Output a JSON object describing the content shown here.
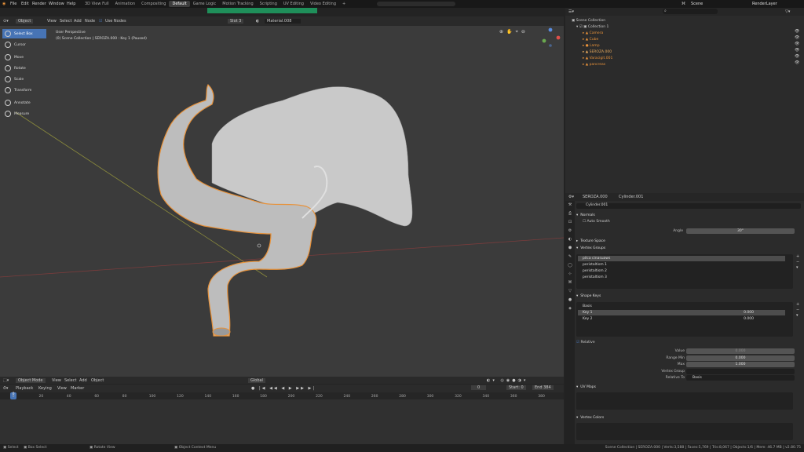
{
  "menu": [
    "File",
    "Edit",
    "Render",
    "Window",
    "Help"
  ],
  "workspaces": [
    "3D View Full",
    "Animation",
    "Compositing",
    "Default",
    "Game Logic",
    "Motion Tracking",
    "Scripting",
    "UV Editing",
    "Video Editing"
  ],
  "active_workspace": "Default",
  "scene": {
    "label": "Scene",
    "layer": "RenderLayer"
  },
  "viewport_header": {
    "mode": "Object",
    "view": "View",
    "select": "Select",
    "add": "Add",
    "node": "Node",
    "use_nodes": "Use Nodes",
    "slot": "Slot 3",
    "material": "Material.008"
  },
  "toolbar": [
    {
      "label": "Select Box",
      "active": true,
      "icon": "select-box-icon"
    },
    {
      "label": "Cursor",
      "icon": "cursor-icon"
    },
    {
      "label": "Move",
      "icon": "move-icon"
    },
    {
      "label": "Rotate",
      "icon": "rotate-icon"
    },
    {
      "label": "Scale",
      "icon": "scale-icon"
    },
    {
      "label": "Transform",
      "icon": "transform-icon"
    },
    {
      "label": "Annotate",
      "icon": "annotate-icon"
    },
    {
      "label": "Measure",
      "icon": "measure-icon"
    }
  ],
  "viewport_info": {
    "line1": "User Perspective",
    "line2": "(0) Scene Collection | SEROZA.000 : Key 1 (Paused)"
  },
  "viewport_footer": {
    "mode": "Object Mode",
    "view": "View",
    "select": "Select",
    "add": "Add",
    "object": "Object",
    "orientation": "Global"
  },
  "outliner": {
    "title": "Scene Collection",
    "collection": "Collection 1",
    "items": [
      "Camera",
      "Cube",
      "Lamp",
      "SEROZA.000",
      "Varacigit.001",
      "pancreas"
    ]
  },
  "properties": {
    "object": "SEROZA.000",
    "mesh": "Cylinder.001",
    "data_name": "Cylinder.001",
    "normals": "Normals",
    "auto_smooth": "Auto Smooth",
    "angle_label": "Angle",
    "angle_value": "30°",
    "texture_space": "Texture Space",
    "vertex_groups": "Vertex Groups",
    "vg_items": [
      "pilca cinasuaws",
      "peristaltism 1",
      "peristaltism 2",
      "peristaltism 3"
    ],
    "shape_keys": "Shape Keys",
    "sk_items": [
      {
        "name": "Basis",
        "value": ""
      },
      {
        "name": "Key 1",
        "value": "0.000"
      },
      {
        "name": "Key 2",
        "value": "0.000"
      }
    ],
    "relative": "Relative",
    "value_label": "Value",
    "value": "0.000",
    "range_min_label": "Range Min",
    "range_min": "0.000",
    "max_label": "Max",
    "max": "1.000",
    "vertex_group_label": "Vertex Group",
    "relative_to_label": "Relative To",
    "relative_to": "Basis",
    "uv_maps": "UV Maps",
    "vertex_colors": "Vertex Colors"
  },
  "timeline": {
    "playback": "Playback",
    "keying": "Keying",
    "view": "View",
    "marker": "Marker",
    "current": "0",
    "start_label": "Start",
    "start": "0",
    "end_label": "End",
    "end": "384",
    "ticks": [
      "0",
      "20",
      "40",
      "60",
      "80",
      "100",
      "120",
      "140",
      "160",
      "180",
      "200",
      "220",
      "240",
      "260",
      "280",
      "300",
      "320",
      "340",
      "360",
      "380"
    ]
  },
  "status": {
    "left1": "Select",
    "left2": "Box Select",
    "left3": "Rotate View",
    "left4": "Object Context Menu",
    "right": "Scene Collection | SEROZA.000 | Verts:3,588 | Faces:5,769 | Tris:8,067 | Objects:1/6 | Mem: 46.7 MB | v2.80.75"
  },
  "colors": {
    "accent": "#4774b5",
    "selection": "#e8923a",
    "bg": "#3b3b3b",
    "green": "#1f8f5a"
  }
}
